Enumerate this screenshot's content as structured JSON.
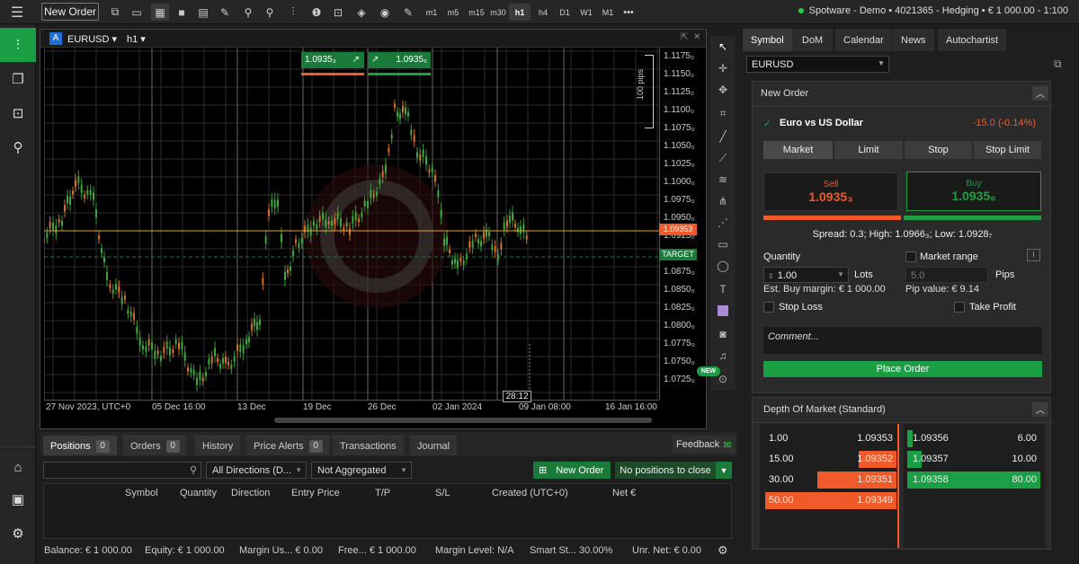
{
  "topbar": {
    "new_order_label": "New Order",
    "timeframes": [
      "m1",
      "m5",
      "m15",
      "m30",
      "h1",
      "h4",
      "D1",
      "W1",
      "M1"
    ],
    "active_timeframe": "h1",
    "more": "•••",
    "account_info": "Spotware - Demo • 4021365 - Hedging • € 1 000.00 - 1:100"
  },
  "chart": {
    "badge": "A",
    "symbol": "EURUSD",
    "timeframe": "h1",
    "sell_quote": "1.0935₃",
    "buy_quote": "1.0935₆",
    "pips_ruler": "100 pips",
    "current_price_tag": "1.09353",
    "target_tag": "TARGET",
    "countdown": "28:12",
    "y_ticks": [
      "1.1175₀",
      "1.1150₀",
      "1.1125₀",
      "1.1100₀",
      "1.1075₀",
      "1.1050₀",
      "1.1025₀",
      "1.1000₀",
      "1.0975₀",
      "1.0950₀",
      "1.0925₀",
      "1.0900₀",
      "1.0875₀",
      "1.0850₀",
      "1.0825₀",
      "1.0800₀",
      "1.0775₀",
      "1.0750₀",
      "1.0725₀"
    ],
    "x_ticks": [
      "27 Nov 2023, UTC+0",
      "05 Dec 16:00",
      "13 Dec",
      "19 Dec",
      "26 Dec",
      "02 Jan 2024",
      "09 Jan 08:00",
      "16 Jan 16:00"
    ],
    "new_badge": "NEW"
  },
  "bottom": {
    "tabs": [
      {
        "label": "Positions",
        "count": "0"
      },
      {
        "label": "Orders",
        "count": "0"
      },
      {
        "label": "History"
      },
      {
        "label": "Price Alerts",
        "count": "0"
      },
      {
        "label": "Transactions"
      },
      {
        "label": "Journal"
      }
    ],
    "feedback": "Feedback",
    "direction_filter": "All Directions (D...",
    "aggregation_filter": "Not Aggregated",
    "new_order_btn": "New Order",
    "close_btn": "No positions to close",
    "columns": [
      "Symbol",
      "Quantity",
      "Direction",
      "Entry Price",
      "T/P",
      "S/L",
      "Created (UTC+0)",
      "Net €"
    ],
    "status": {
      "balance": "Balance: € 1 000.00",
      "equity": "Equity: € 1 000.00",
      "margin_used": "Margin Us... € 0.00",
      "free_margin": "Free... € 1 000.00",
      "margin_level": "Margin Level: N/A",
      "smart_stop": "Smart St... 30.00%",
      "unr_net": "Unr. Net: € 0.00"
    }
  },
  "right": {
    "tabs": [
      "Symbol",
      "DoM",
      "Calendar",
      "News",
      "Autochartist"
    ],
    "symbol_select": "EURUSD",
    "new_order_title": "New Order",
    "pair_name": "Euro vs US Dollar",
    "change": "-15.0 (-0.14%)",
    "order_types": [
      "Market",
      "Limit",
      "Stop",
      "Stop Limit"
    ],
    "sell_label": "Sell",
    "sell_price": "1.0935₃",
    "buy_label": "Buy",
    "buy_price": "1.0935₆",
    "spread_info": "Spread: 0.3; High: 1.0966₃; Low: 1.0928₇",
    "quantity_label": "Quantity",
    "quantity_value": "1.00",
    "lots": "Lots",
    "market_range": "Market range",
    "range_value": "5.0",
    "pips": "Pips",
    "est_margin": "Est. Buy margin: € 1 000.00",
    "pip_value": "Pip value: € 9.14",
    "stop_loss": "Stop Loss",
    "take_profit": "Take Profit",
    "comment_placeholder": "Comment...",
    "place_order": "Place Order",
    "dom_title": "Depth Of Market (Standard)",
    "dom_sell": [
      {
        "vol": "1.00",
        "price": "1.09353"
      },
      {
        "vol": "15.00",
        "price": "1.09352"
      },
      {
        "vol": "30.00",
        "price": "1.09351"
      },
      {
        "vol": "50.00",
        "price": "1.09349"
      }
    ],
    "dom_buy": [
      {
        "price": "1.09356",
        "vol": "6.00"
      },
      {
        "price": "1.09357",
        "vol": "10.00"
      },
      {
        "price": "1.09358",
        "vol": "80.00"
      }
    ]
  },
  "colors": {
    "sell": "#f05a28",
    "buy": "#1a9f44",
    "bg": "#000000"
  }
}
